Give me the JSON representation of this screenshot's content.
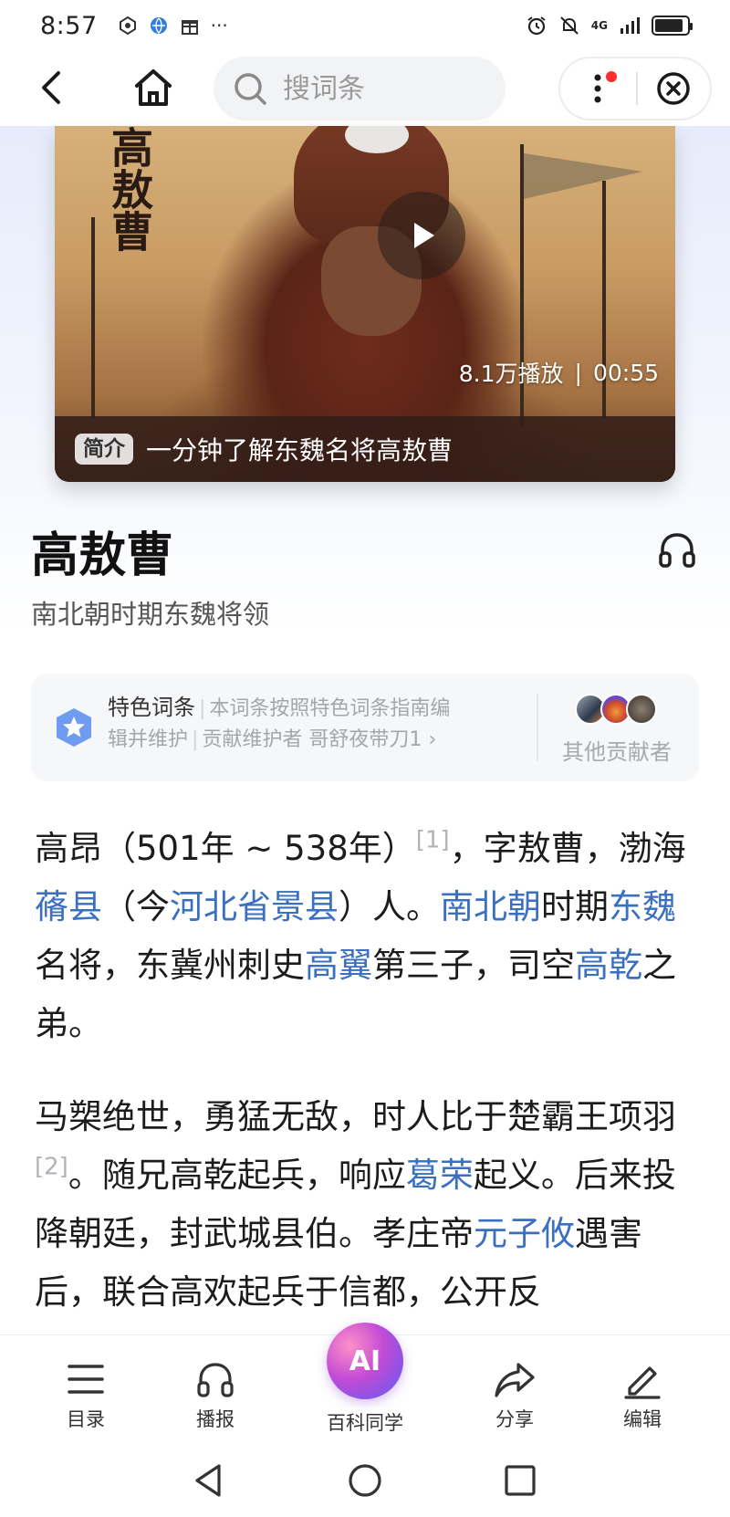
{
  "status_bar": {
    "time": "8:57",
    "left_icons": [
      "notification-icon",
      "browser-icon",
      "gift-icon",
      "more-notifications-icon"
    ],
    "overflow_indicator": "···",
    "network": "4G",
    "right_icons": [
      "alarm-icon",
      "mute-icon",
      "signal-icon",
      "battery-icon"
    ]
  },
  "nav": {
    "back_icon": "back-chevron-icon",
    "home_icon": "home-icon",
    "search_placeholder": "搜词条",
    "more_icon": "more-vertical-icon",
    "close_icon": "close-circle-icon"
  },
  "video": {
    "calligraphy_text": "高敖曹",
    "play_count": "8.1万播放",
    "separator": "|",
    "duration": "00:55",
    "badge": "简介",
    "caption": "一分钟了解东魏名将高敖曹"
  },
  "entry": {
    "title": "高敖曹",
    "subtitle": "南北朝时期东魏将领",
    "listen_icon": "headphones-icon"
  },
  "featured": {
    "label": "特色词条",
    "sep": "|",
    "line1_rest": "本词条按照特色词条指南编",
    "line2_a": "辑并维护",
    "line2_b": "贡献维护者 哥舒夜带刀1",
    "chevron": "›",
    "others_label": "其他贡献者"
  },
  "paragraph1": {
    "t1": "高昂（501年 ~ 538年）",
    "ref1": "[1]",
    "t2": "，字敖曹，渤海",
    "l1": "蓨县",
    "t3": "（今",
    "l2": "河北省景县",
    "t4": "）人。",
    "l3": "南北朝",
    "t5": "时期",
    "l4": "东魏",
    "t6": "名将，东冀州刺史",
    "l5": "高翼",
    "t7": "第三子，司空",
    "l6": "高乾",
    "t8": "之弟。"
  },
  "paragraph2": {
    "t1": "马槊绝世，勇猛无敌，时人比于楚霸王项羽",
    "ref2": "[2]",
    "t2": "。随兄高乾起兵，响应",
    "l1": "葛荣",
    "t3": "起义。后来投降朝廷，封武城县伯。孝庄帝",
    "l2": "元子攸",
    "t4": "遇害后，联合高欢起兵于信都，公开反"
  },
  "toolbar": {
    "items": [
      {
        "label": "目录",
        "icon": "list-icon"
      },
      {
        "label": "播报",
        "icon": "headphones-icon"
      },
      {
        "label": "百科同学",
        "icon": "ai-assistant-icon",
        "badge": "AI"
      },
      {
        "label": "分享",
        "icon": "share-icon"
      },
      {
        "label": "编辑",
        "icon": "edit-pencil-icon"
      }
    ]
  },
  "system_nav": {
    "back_icon": "triangle-back-icon",
    "home_icon": "circle-home-icon",
    "recents_icon": "square-recents-icon"
  },
  "colors": {
    "link": "#3b6fbf",
    "ai_gradient": [
      "#ff8fc7",
      "#c24bd6",
      "#5b5cf0"
    ],
    "red_dot": "#ff2d2d"
  }
}
